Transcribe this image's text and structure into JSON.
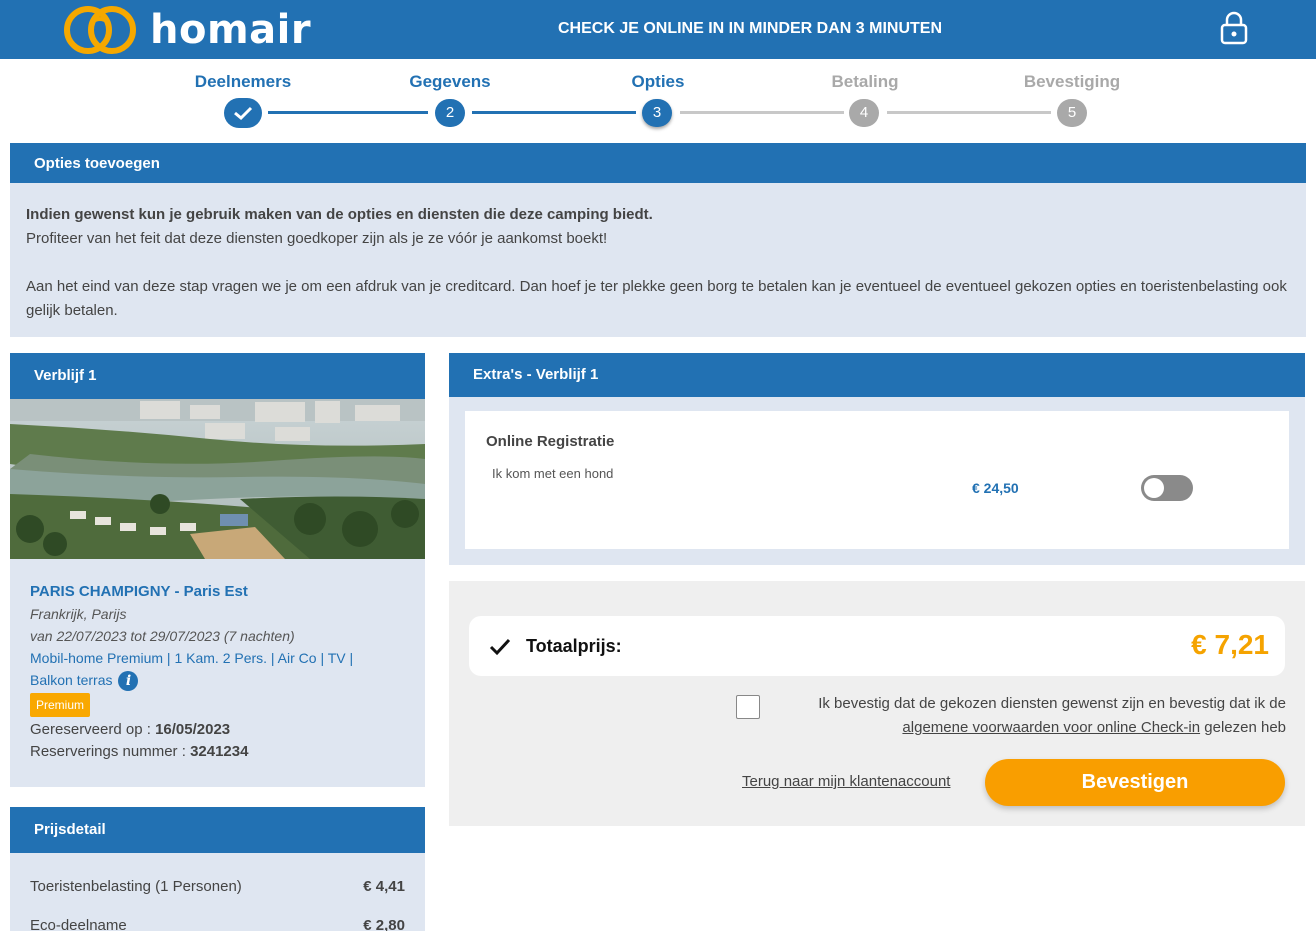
{
  "header": {
    "logo_text": "homair",
    "tagline": "CHECK JE ONLINE IN IN MINDER DAN 3 MINUTEN"
  },
  "steps": [
    {
      "label": "Deelnemers",
      "number": "",
      "state": "done"
    },
    {
      "label": "Gegevens",
      "number": "2",
      "state": "done"
    },
    {
      "label": "Opties",
      "number": "3",
      "state": "current"
    },
    {
      "label": "Betaling",
      "number": "4",
      "state": "pending"
    },
    {
      "label": "Bevestiging",
      "number": "5",
      "state": "pending"
    }
  ],
  "options": {
    "title": "Opties toevoegen",
    "intro_bold": "Indien gewenst kun je gebruik maken van de opties en diensten die deze camping biedt.",
    "intro_line2": "Profiteer van het feit dat deze diensten goedkoper zijn als je ze vóór je aankomst boekt!",
    "intro_para2": "Aan het eind van deze stap vragen we je om een afdruk van je creditcard. Dan hoef je ter plekke geen borg te betalen kan je eventueel de eventueel gekozen opties en toeristenbelasting ook gelijk betalen."
  },
  "stay": {
    "title": "Verblijf 1",
    "camp_name": "PARIS CHAMPIGNY - Paris Est",
    "location": "Frankrijk, Parijs",
    "dates": "van 22/07/2023 tot 29/07/2023 (7 nachten)",
    "accommodation_line1": "Mobil-home Premium | 1 Kam. 2 Pers. | Air Co | TV |",
    "accommodation_line2": "Balkon terras",
    "badge": "Premium",
    "reserved_label": "Gereserveerd op : ",
    "reserved_date": "16/05/2023",
    "reservation_label": "Reserverings nummer : ",
    "reservation_number": "3241234"
  },
  "price_detail": {
    "title": "Prijsdetail",
    "rows": [
      {
        "label": "Toeristenbelasting (1 Personen)",
        "amount": "€ 4,41"
      },
      {
        "label": "Eco-deelname",
        "amount": "€ 2,80"
      }
    ]
  },
  "extras": {
    "title": "Extra's - Verblijf 1",
    "item_title": "Online Registratie",
    "item_sub": "Ik kom met een hond",
    "item_price": "€ 24,50",
    "toggle_on": false
  },
  "summary": {
    "total_label": "Totaalprijs:",
    "total_value": "€ 7,21",
    "confirm_text": "Ik bevestig dat de gekozen diensten gewenst zijn en bevestig dat ik de",
    "terms_link": "algemene voorwaarden voor online Check-in",
    "confirm_suffix": " gelezen heb",
    "back_link": "Terug naar mijn klantenaccount",
    "confirm_button": "Bevestigen"
  },
  "colors": {
    "brand_blue": "#2271b3",
    "accent_orange": "#f99e00",
    "logo_yellow": "#f5a800",
    "panel_light": "#dfe6f1",
    "pending_grey": "#a9a9a9"
  }
}
